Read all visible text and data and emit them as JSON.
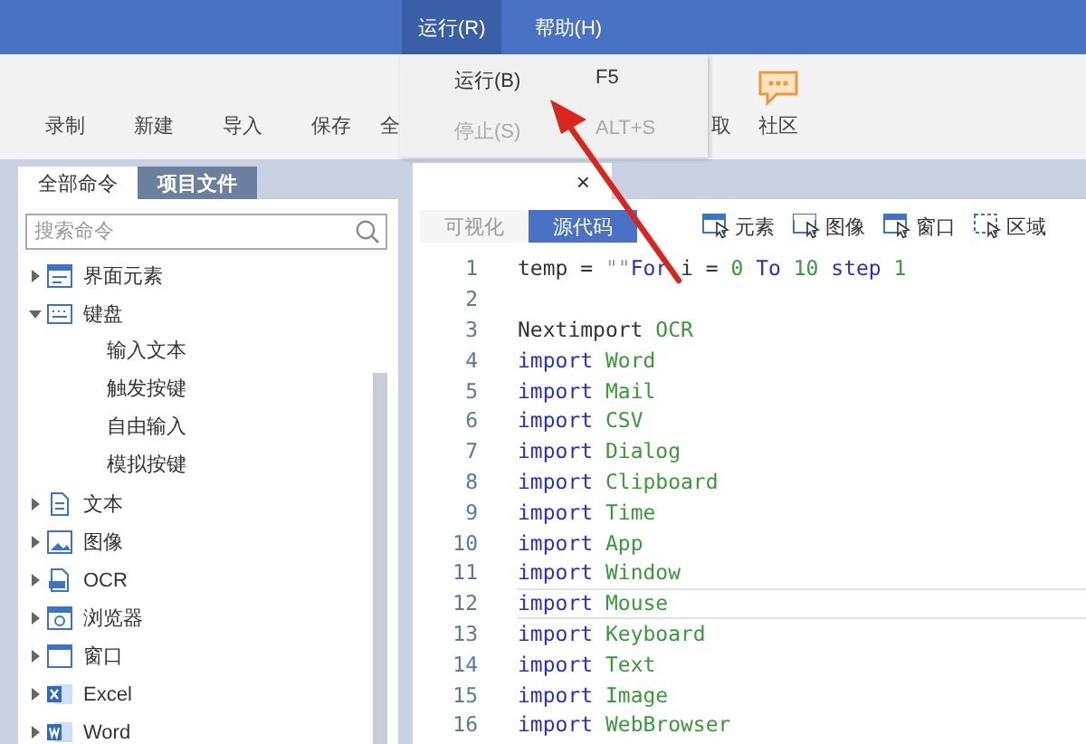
{
  "menu_bar": [
    {
      "label": "运行(R)",
      "selected": true
    },
    {
      "label": "帮助(H)",
      "selected": false
    }
  ],
  "menu": [
    {
      "label": "运行(B)",
      "shortcut": "F5",
      "disabled": false
    },
    {
      "label": "停止(S)",
      "shortcut": "ALT+S",
      "disabled": true
    }
  ],
  "toolbar": {
    "left": [
      "录制",
      "新建",
      "导入",
      "保存",
      "全"
    ],
    "right": [
      {
        "label": "取",
        "kind": "text"
      },
      {
        "label": "社区",
        "kind": "chat"
      }
    ]
  },
  "panel_tabs": [
    {
      "label": "全部命令",
      "selected": true
    },
    {
      "label": "项目文件",
      "selected": false
    }
  ],
  "search": {
    "placeholder": "搜索命令"
  },
  "tree": [
    {
      "label": "界面元素",
      "kind": "ui",
      "expanded": false
    },
    {
      "label": "键盘",
      "kind": "keyboard",
      "expanded": true,
      "children": [
        {
          "label": "输入文本"
        },
        {
          "label": "触发按键"
        },
        {
          "label": "自由输入"
        },
        {
          "label": "模拟按键"
        }
      ]
    },
    {
      "label": "文本",
      "kind": "doc",
      "expanded": false
    },
    {
      "label": "图像",
      "kind": "image",
      "expanded": false
    },
    {
      "label": "OCR",
      "kind": "ocr",
      "expanded": false
    },
    {
      "label": "浏览器",
      "kind": "browser",
      "expanded": false
    },
    {
      "label": "窗口",
      "kind": "window",
      "expanded": false
    },
    {
      "label": "Excel",
      "kind": "excel",
      "expanded": false
    },
    {
      "label": "Word",
      "kind": "word",
      "expanded": false
    }
  ],
  "editor_tab": {
    "close": "×"
  },
  "view_tabs": [
    {
      "label": "可视化",
      "selected": false
    },
    {
      "label": "源代码",
      "selected": true
    }
  ],
  "capture_buttons": [
    "元素",
    "图像",
    "窗口",
    "区域"
  ],
  "code": [
    {
      "number": "1",
      "selected": false,
      "tokens": [
        {
          "kind": "plain",
          "text": "temp = "
        },
        {
          "kind": "string",
          "text": "\"\""
        },
        {
          "kind": "keyword",
          "text": "For"
        },
        {
          "kind": "plain",
          "text": " i = "
        },
        {
          "kind": "number",
          "text": "0"
        },
        {
          "kind": "keyword",
          "text": " To "
        },
        {
          "kind": "number",
          "text": "10"
        },
        {
          "kind": "keyword",
          "text": " step "
        },
        {
          "kind": "number",
          "text": "1"
        }
      ]
    },
    {
      "number": "2",
      "selected": false
    },
    {
      "number": "3",
      "selected": false,
      "tokens": [
        {
          "kind": "plain",
          "text": "Nextimport "
        },
        {
          "kind": "name",
          "text": "OCR"
        }
      ]
    },
    {
      "number": "4",
      "selected": false,
      "tokens": [
        {
          "kind": "keyword",
          "text": "import "
        },
        {
          "kind": "name",
          "text": "Word"
        }
      ]
    },
    {
      "number": "5",
      "selected": false,
      "tokens": [
        {
          "kind": "keyword",
          "text": "import "
        },
        {
          "kind": "name",
          "text": "Mail"
        }
      ]
    },
    {
      "number": "6",
      "selected": false,
      "tokens": [
        {
          "kind": "keyword",
          "text": "import "
        },
        {
          "kind": "name",
          "text": "CSV"
        }
      ]
    },
    {
      "number": "7",
      "selected": false,
      "tokens": [
        {
          "kind": "keyword",
          "text": "import "
        },
        {
          "kind": "name",
          "text": "Dialog"
        }
      ]
    },
    {
      "number": "8",
      "selected": false,
      "tokens": [
        {
          "kind": "keyword",
          "text": "import "
        },
        {
          "kind": "name",
          "text": "Clipboard"
        }
      ]
    },
    {
      "number": "9",
      "selected": false,
      "tokens": [
        {
          "kind": "keyword",
          "text": "import "
        },
        {
          "kind": "name",
          "text": "Time"
        }
      ]
    },
    {
      "number": "10",
      "selected": false,
      "tokens": [
        {
          "kind": "keyword",
          "text": "import "
        },
        {
          "kind": "name",
          "text": "App"
        }
      ]
    },
    {
      "number": "11",
      "selected": false,
      "tokens": [
        {
          "kind": "keyword",
          "text": "import "
        },
        {
          "kind": "name",
          "text": "Window"
        }
      ]
    },
    {
      "number": "12",
      "selected": true,
      "tokens": [
        {
          "kind": "keyword",
          "text": "import "
        },
        {
          "kind": "name",
          "text": "Mouse"
        }
      ]
    },
    {
      "number": "13",
      "selected": false,
      "tokens": [
        {
          "kind": "keyword",
          "text": "import "
        },
        {
          "kind": "name",
          "text": "Keyboard"
        }
      ]
    },
    {
      "number": "14",
      "selected": false,
      "tokens": [
        {
          "kind": "keyword",
          "text": "import "
        },
        {
          "kind": "name",
          "text": "Text"
        }
      ]
    },
    {
      "number": "15",
      "selected": false,
      "tokens": [
        {
          "kind": "keyword",
          "text": "import "
        },
        {
          "kind": "name",
          "text": "Image"
        }
      ]
    },
    {
      "number": "16",
      "selected": false,
      "tokens": [
        {
          "kind": "keyword",
          "text": "import "
        },
        {
          "kind": "name",
          "text": "WebBrowser"
        }
      ]
    }
  ]
}
